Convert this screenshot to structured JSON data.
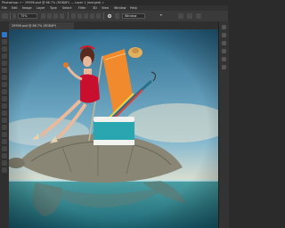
{
  "window": {
    "title": "Photoshop: «~ 29956.psd @ 66.7% (RGB/8*) — Layer 1 (merged) »"
  },
  "menu": [
    "File",
    "Edit",
    "Image",
    "Layer",
    "Type",
    "Select",
    "Filter",
    "3D",
    "View",
    "Window",
    "Help"
  ],
  "options": {
    "zoom": "75%",
    "mode": "Window",
    "mode_icon": "settings-gear-icon"
  },
  "document_tab": {
    "label": "29956.psd @ 66.7% (RGB/8*)"
  },
  "colors": {
    "accent": "#2d77c8",
    "panel": "#333333"
  }
}
